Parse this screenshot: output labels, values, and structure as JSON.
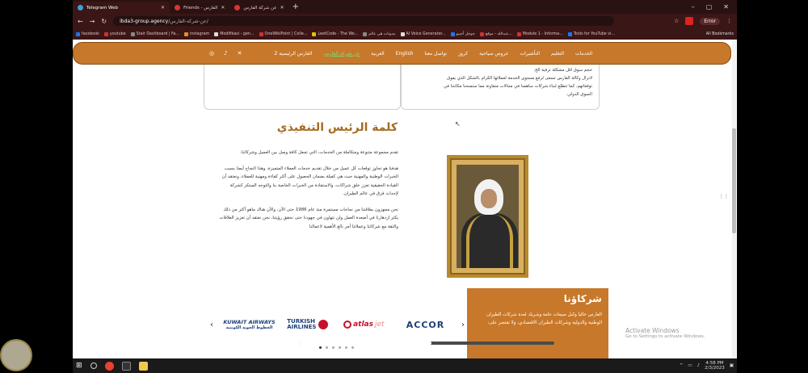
{
  "browser": {
    "tabs": [
      {
        "title": "Telegram Web",
        "active": true
      },
      {
        "title": "Friends - الفارس",
        "active": false
      },
      {
        "title": "عن شركة الفارس",
        "active": false
      }
    ],
    "url_domain": "ibda3-group.agency",
    "url_path": "/عن-شركة-الفارس/",
    "error_label": "Error",
    "bookmarks": [
      "facebook",
      "youtube",
      "Stair Dashboard | Fa...",
      "instagram",
      "Modifikasi - gen...",
      "OneWikiPoint | Colle...",
      "LeetCode - The Wo...",
      "مدونات هي عالم",
      "AI Voice Generator...",
      "جوجل أجيبو",
      "عبدالله - موقع...",
      "Module 1 - Informa...",
      "Tools for YouTube vi..."
    ],
    "all_bookmarks_label": "All Bookmarks"
  },
  "nav": {
    "items": [
      "الخدمات",
      "التعليم",
      "التأشيرات",
      "عروض سياحية",
      "كروز",
      "تواصل معنا",
      "English",
      "العربية",
      "عن شركة الفارس",
      "الفارس الرئيسية 2"
    ],
    "current_index": 8,
    "social_icons": [
      "instagram-icon",
      "tiktok-icon",
      "twitter-icon"
    ]
  },
  "about_card": {
    "lines": [
      "حجم سوق اقل مشكلة ترقية الخ.",
      "لانزال وكالة الفارس تسعى لرفع مستوى الخدمة لعملائها الكرام بالشكل الذي يفوق",
      "توقعاتهم، كما تتطلع لبناء شركات ساهمنا في مجالات متفاوتة مما ستمنحنا مكانتنا في",
      "السوق الدولي."
    ]
  },
  "exec": {
    "title": "كلمة الرئيس التنفيذي",
    "paragraphs": [
      "تقدم مجموعة متنوعة ومتكاملة من الخدمات، التي تجعل كافة وصل بين العميل وشركائنا.",
      "هدفنا هو تجاوز توقعات كل عميل من خلال تقديم خدمات العملاء المتميزة، وهذا النجاح أيضا بسبب الخبرات الوطنية والمهنية حيث هي كفيلة بضمان الحصول على أكثر كفاءة ومهنية للعملاء، ونعتقد أن القيادة الحقيقية تعزز خلق شراكات، والاستفادة من الخبرات الخاصة بنا والتوجه المبتكر كشركة لإحداث فرق في عالم الطيران.",
      "نحن مجهزون بعلاقتنا من نجاحات مستمرة منذ عام 1986 حتى الآن، والآن هناك ماهو أكثر من ذلك يكثر ازدهارنا في أصعدة العمل ولن نتهاون في جهودنا حتى نحقق رؤيتنا، نحن نعتقد أن تعزيز العلاقات والثقة مع شركائنا وعملائنا أمر بالغ الأهمية لاعمالنا"
    ]
  },
  "partners": {
    "title": "شركاؤنا",
    "text": "الفارس حاليا وكيل مبيعات عامة وشريك لعدة شركات الطيران الوطنية والدولية وشركات الطيران الاقتصادي، ولا تقتصر على:"
  },
  "logos": {
    "kuwait": "KUWAIT AIRWAYS",
    "kuwait_ar": "الخطوط الجوية الكويتية",
    "turkish_line1": "TURKISH",
    "turkish_line2": "AIRLINES",
    "atlas1": "atlas",
    "atlas2": "jet",
    "accor": "ACCOR"
  },
  "watermark": {
    "line1": "Activate Windows",
    "line2": "Go to Settings to activate Windows."
  },
  "video_progress": 0.52,
  "taskbar": {
    "time": "4:58 PM",
    "date": "2/3/2023"
  }
}
